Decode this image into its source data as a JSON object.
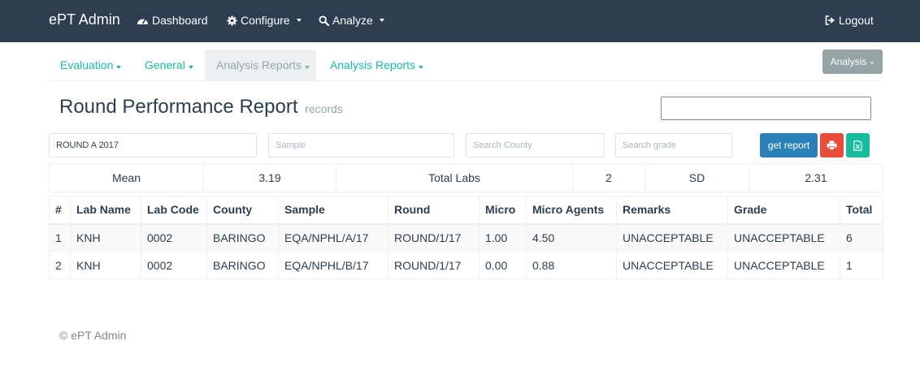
{
  "navbar": {
    "brand": "ePT Admin",
    "dashboard": "Dashboard",
    "configure": "Configure",
    "analyze": "Analyze",
    "logout": "Logout"
  },
  "tabs": [
    {
      "label": "Evaluation"
    },
    {
      "label": "General"
    },
    {
      "label": "Analysis Reports"
    },
    {
      "label": "Analysis Reports"
    }
  ],
  "analysis_button": "Analysis",
  "page": {
    "title": "Round Performance Report",
    "subtitle": "records",
    "top_search_value": ""
  },
  "filters": {
    "round_value": "ROUND A 2017",
    "sample_placeholder": "Sample",
    "county_placeholder": "Search County",
    "grade_placeholder": "Search grade",
    "get_report_label": "get report"
  },
  "stats": {
    "mean_label": "Mean",
    "mean_value": "3.19",
    "total_labs_label": "Total Labs",
    "total_labs_value": "2",
    "sd_label": "SD",
    "sd_value": "2.31"
  },
  "table": {
    "headers": [
      "#",
      "Lab Name",
      "Lab Code",
      "County",
      "Sample",
      "Round",
      "Micro",
      "Micro Agents",
      "Remarks",
      "Grade",
      "Total"
    ],
    "rows": [
      [
        "1",
        "KNH",
        "0002",
        "BARINGO",
        "EQA/NPHL/A/17",
        "ROUND/1/17",
        "1.00",
        "4.50",
        "UNACCEPTABLE",
        "UNACCEPTABLE",
        "6"
      ],
      [
        "2",
        "KNH",
        "0002",
        "BARINGO",
        "EQA/NPHL/B/17",
        "ROUND/1/17",
        "0.00",
        "0.88",
        "UNACCEPTABLE",
        "UNACCEPTABLE",
        "1"
      ]
    ]
  },
  "footer": "© ePT Admin",
  "colors": {
    "navbar": "#2c3e50",
    "link": "#18bc9c",
    "primary": "#2980b9",
    "danger": "#e74c3c",
    "success": "#18bc9c",
    "muted": "#95a5a6"
  }
}
